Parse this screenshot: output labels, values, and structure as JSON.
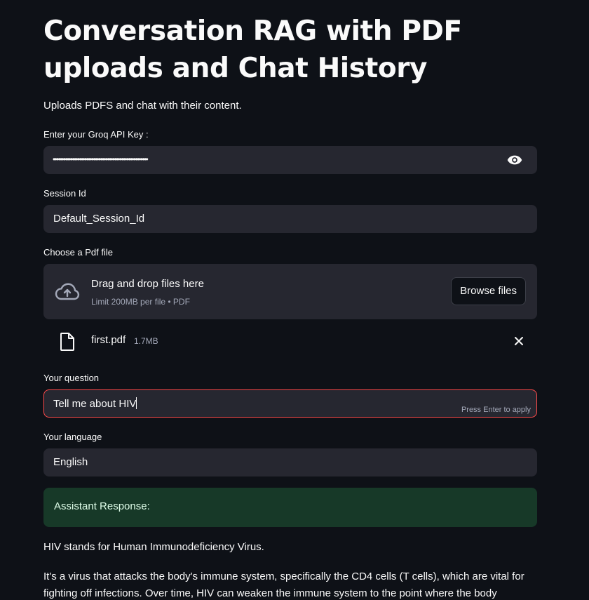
{
  "page": {
    "title": "Conversation RAG with PDF uploads and Chat History",
    "subtitle": "Uploads PDFS and chat with their content."
  },
  "api_key": {
    "label": "Enter your Groq API Key :",
    "masked_value": "••••••••••••••••••••••••••••••••••••••••••••••••••••••",
    "toggle_icon": "eye-icon"
  },
  "session": {
    "label": "Session Id",
    "value": "Default_Session_Id"
  },
  "uploader": {
    "label": "Choose a Pdf file",
    "drop_title": "Drag and drop files here",
    "limit_text": "Limit 200MB per file • PDF",
    "browse_label": "Browse files",
    "icon": "cloud-upload-icon"
  },
  "uploaded_file": {
    "name": "first.pdf",
    "size": "1.7MB",
    "icon": "file-icon",
    "remove_icon": "close-icon"
  },
  "question": {
    "label": "Your question",
    "value": "Tell me about HIV",
    "hint": "Press Enter to apply"
  },
  "language": {
    "label": "Your language",
    "value": "English"
  },
  "response": {
    "heading": "Assistant Response:",
    "paragraphs": [
      "HIV stands for Human Immunodeficiency Virus.",
      "It's a virus that attacks the body's immune system, specifically the CD4 cells (T cells), which are vital for fighting off infections. Over time, HIV can weaken the immune system to the point where the body"
    ]
  },
  "colors": {
    "background": "#0e1117",
    "input_background": "#262730",
    "focus_border": "#ff4b4b",
    "success_background": "#173928",
    "success_text": "#dffde9"
  }
}
